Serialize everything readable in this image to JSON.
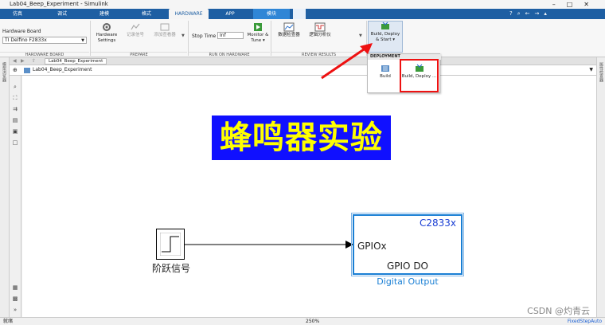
{
  "window": {
    "title": "Lab04_Beep_Experiment - Simulink"
  },
  "tabs": [
    {
      "label": "仿真",
      "active": false
    },
    {
      "label": "调试",
      "active": false
    },
    {
      "label": "建模",
      "active": false
    },
    {
      "label": "格式",
      "active": false
    },
    {
      "label": "HARDWARE",
      "active": true
    },
    {
      "label": "APP",
      "active": false
    },
    {
      "label": "模块",
      "active": false,
      "highlight": true
    }
  ],
  "ribbon": {
    "hardware_board_label": "Hardware Board",
    "hardware_board_value": "TI Delfino F2833x",
    "hardware_settings": "Hardware Settings",
    "log_signals": "记录信号",
    "add_viewer": "添加查看器",
    "stop_time_label": "Stop Time",
    "stop_time_value": "Inf",
    "monitor_tune": "Monitor & Tune",
    "data_inspector": "数据检查器",
    "logic_analyzer": "逻辑分析仪",
    "build_deploy_start": "Build, Deploy & Start",
    "sections": {
      "hardware_board": "HARDWARE BOARD",
      "prepare": "PREPARE",
      "run_on_hardware": "RUN ON HARDWARE",
      "review_results": "REVIEW RESULTS"
    }
  },
  "deployment_popup": {
    "header": "DEPLOYMENT",
    "build": "Build",
    "build_deploy": "Build, Deploy ..."
  },
  "editor": {
    "tab_label": "Lab04_Beep_Experiment",
    "breadcrumb": "Lab04_Beep_Experiment"
  },
  "model": {
    "title_banner": "蜂鸣器实验",
    "step_block_label": "阶跃信号",
    "gpio_block": {
      "header": "C2833x",
      "port_label": "GPIOx",
      "body_label": "GPIO DO",
      "caption": "Digital Output"
    }
  },
  "status": {
    "left": "就绪",
    "zoom": "250%",
    "solver": "FixedStepAuto"
  },
  "watermark": "CSDN @灼青云",
  "colors": {
    "accent": "#1e5fa3",
    "banner_bg": "#1010ff",
    "banner_text": "#ffff00",
    "highlight_red": "#e11111",
    "block_blue": "#1a7fd4"
  }
}
